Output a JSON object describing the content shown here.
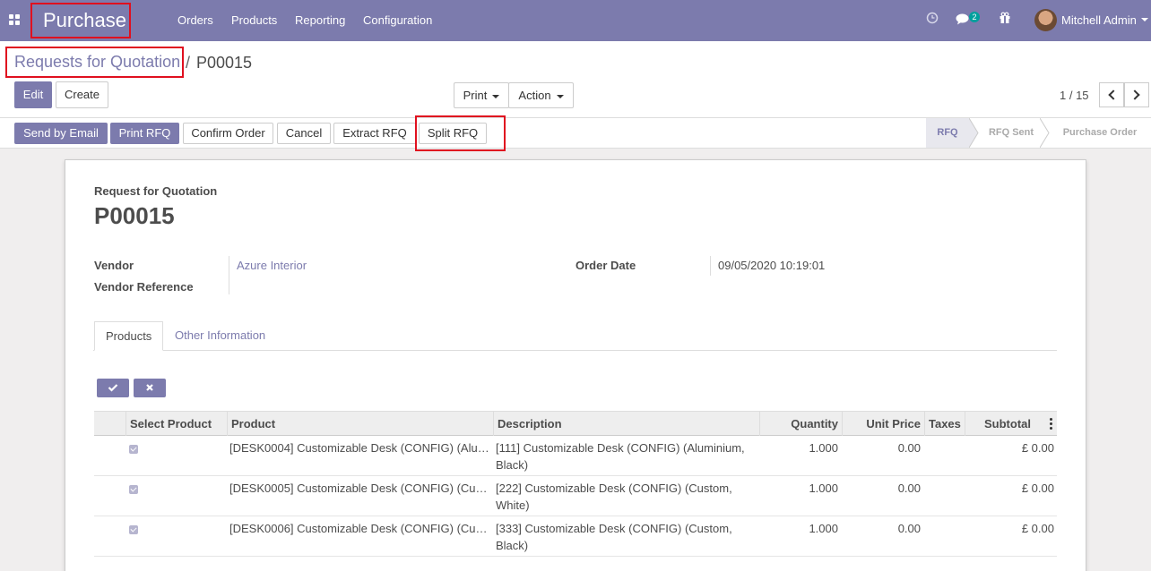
{
  "navbar": {
    "brand": "Purchase",
    "menu": [
      "Orders",
      "Products",
      "Reporting",
      "Configuration"
    ],
    "messages_count": "2",
    "user_name": "Mitchell Admin"
  },
  "breadcrumb": {
    "parent": "Requests for Quotation",
    "separator": "/",
    "current": "P00015"
  },
  "toolbar": {
    "edit": "Edit",
    "create": "Create",
    "print": "Print",
    "action": "Action",
    "pager": "1 / 15"
  },
  "statusbar": {
    "buttons": [
      "Send by Email",
      "Print RFQ",
      "Confirm Order",
      "Cancel",
      "Extract RFQ",
      "Split RFQ"
    ],
    "stages": [
      "RFQ",
      "RFQ Sent",
      "Purchase Order"
    ],
    "active_stage": "RFQ"
  },
  "form": {
    "doc_type": "Request for Quotation",
    "name": "P00015",
    "vendor_label": "Vendor",
    "vendor_value": "Azure Interior",
    "vendor_ref_label": "Vendor Reference",
    "vendor_ref_value": "",
    "order_date_label": "Order Date",
    "order_date_value": "09/05/2020 10:19:01"
  },
  "tabs": [
    "Products",
    "Other Information"
  ],
  "table": {
    "columns": [
      "Select Product",
      "Product",
      "Description",
      "Quantity",
      "Unit Price",
      "Taxes",
      "Subtotal"
    ],
    "rows": [
      {
        "selected": true,
        "product": "[DESK0004] Customizable Desk (CONFIG) (Alu…",
        "description_1": "[111] Customizable Desk (CONFIG) (Aluminium,",
        "description_2": "Black)",
        "quantity": "1.000",
        "unit_price": "0.00",
        "taxes": "",
        "subtotal": "£ 0.00"
      },
      {
        "selected": true,
        "product": "[DESK0005] Customizable Desk (CONFIG) (Cu…",
        "description_1": "[222] Customizable Desk (CONFIG) (Custom,",
        "description_2": "White)",
        "quantity": "1.000",
        "unit_price": "0.00",
        "taxes": "",
        "subtotal": "£ 0.00"
      },
      {
        "selected": true,
        "product": "[DESK0006] Customizable Desk (CONFIG) (Cu…",
        "description_1": "[333] Customizable Desk (CONFIG) (Custom,",
        "description_2": "Black)",
        "quantity": "1.000",
        "unit_price": "0.00",
        "taxes": "",
        "subtotal": "£ 0.00"
      }
    ]
  },
  "colors": {
    "brand": "#7c7bad",
    "highlight": "#e0101f",
    "badge": "#00a09d"
  }
}
